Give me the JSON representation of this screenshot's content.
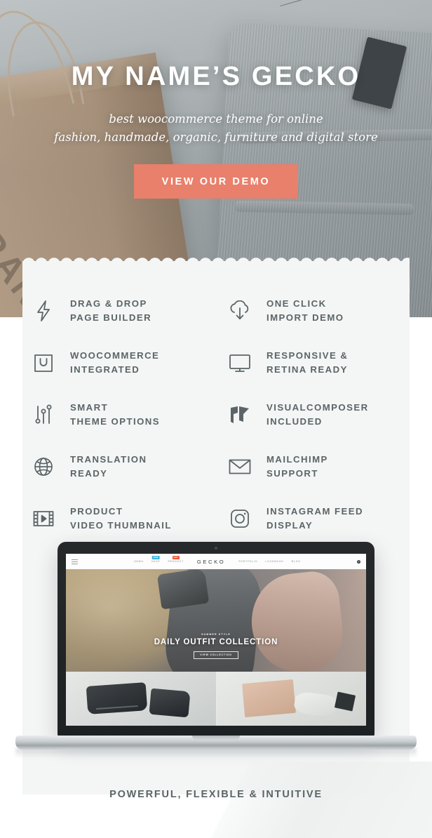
{
  "hero": {
    "title": "MY NAME’S GECKO",
    "subtitle_line1": "best woocommerce theme for online",
    "subtitle_line2": "fashion, handmade, organic, furniture and digital store",
    "cta_label": "VIEW OUR DEMO",
    "cta_color": "#e8806b"
  },
  "features": [
    {
      "icon": "lightning-bolt-icon",
      "line1": "DRAG & DROP",
      "line2": "PAGE BUILDER"
    },
    {
      "icon": "cloud-download-icon",
      "line1": "ONE CLICK",
      "line2": "IMPORT DEMO"
    },
    {
      "icon": "shopping-bag-icon",
      "line1": "WOOCOMMERCE",
      "line2": "INTEGRATED"
    },
    {
      "icon": "monitor-icon",
      "line1": "RESPONSIVE &",
      "line2": "RETINA READY"
    },
    {
      "icon": "sliders-icon",
      "line1": "SMART",
      "line2": "THEME OPTIONS"
    },
    {
      "icon": "visualcomposer-icon",
      "line1": "VISUALCOMPOSER",
      "line2": "INCLUDED"
    },
    {
      "icon": "globe-icon",
      "line1": "TRANSLATION",
      "line2": "READY"
    },
    {
      "icon": "envelope-icon",
      "line1": "MAILCHIMP",
      "line2": "SUPPORT"
    },
    {
      "icon": "film-play-icon",
      "line1": "PRODUCT",
      "line2": "VIDEO THUMBNAIL"
    },
    {
      "icon": "instagram-icon",
      "line1": "INSTAGRAM FEED",
      "line2": "DISPLAY"
    }
  ],
  "preview": {
    "brand": "GECKO",
    "nav": [
      {
        "label": "DEMO",
        "badge": ""
      },
      {
        "label": "SHOP",
        "badge": "NEW"
      },
      {
        "label": "PRODUCT",
        "badge": "HOT"
      },
      {
        "label": "PORTFOLIO",
        "badge": ""
      },
      {
        "label": "LOOKBOOK",
        "badge": ""
      },
      {
        "label": "BLOG",
        "badge": ""
      }
    ],
    "cart_count": "0",
    "hero_eyebrow": "SUMMER STYLE",
    "hero_title": "DAILY OUTFIT COLLECTION",
    "hero_button": "VIEW COLLECTION"
  },
  "footer": {
    "tagline": "POWERFUL, FLEXIBLE & INTUITIVE"
  },
  "colors": {
    "accent": "#e8806b",
    "text": "#5b6567",
    "card_bg": "#f4f5f5"
  }
}
